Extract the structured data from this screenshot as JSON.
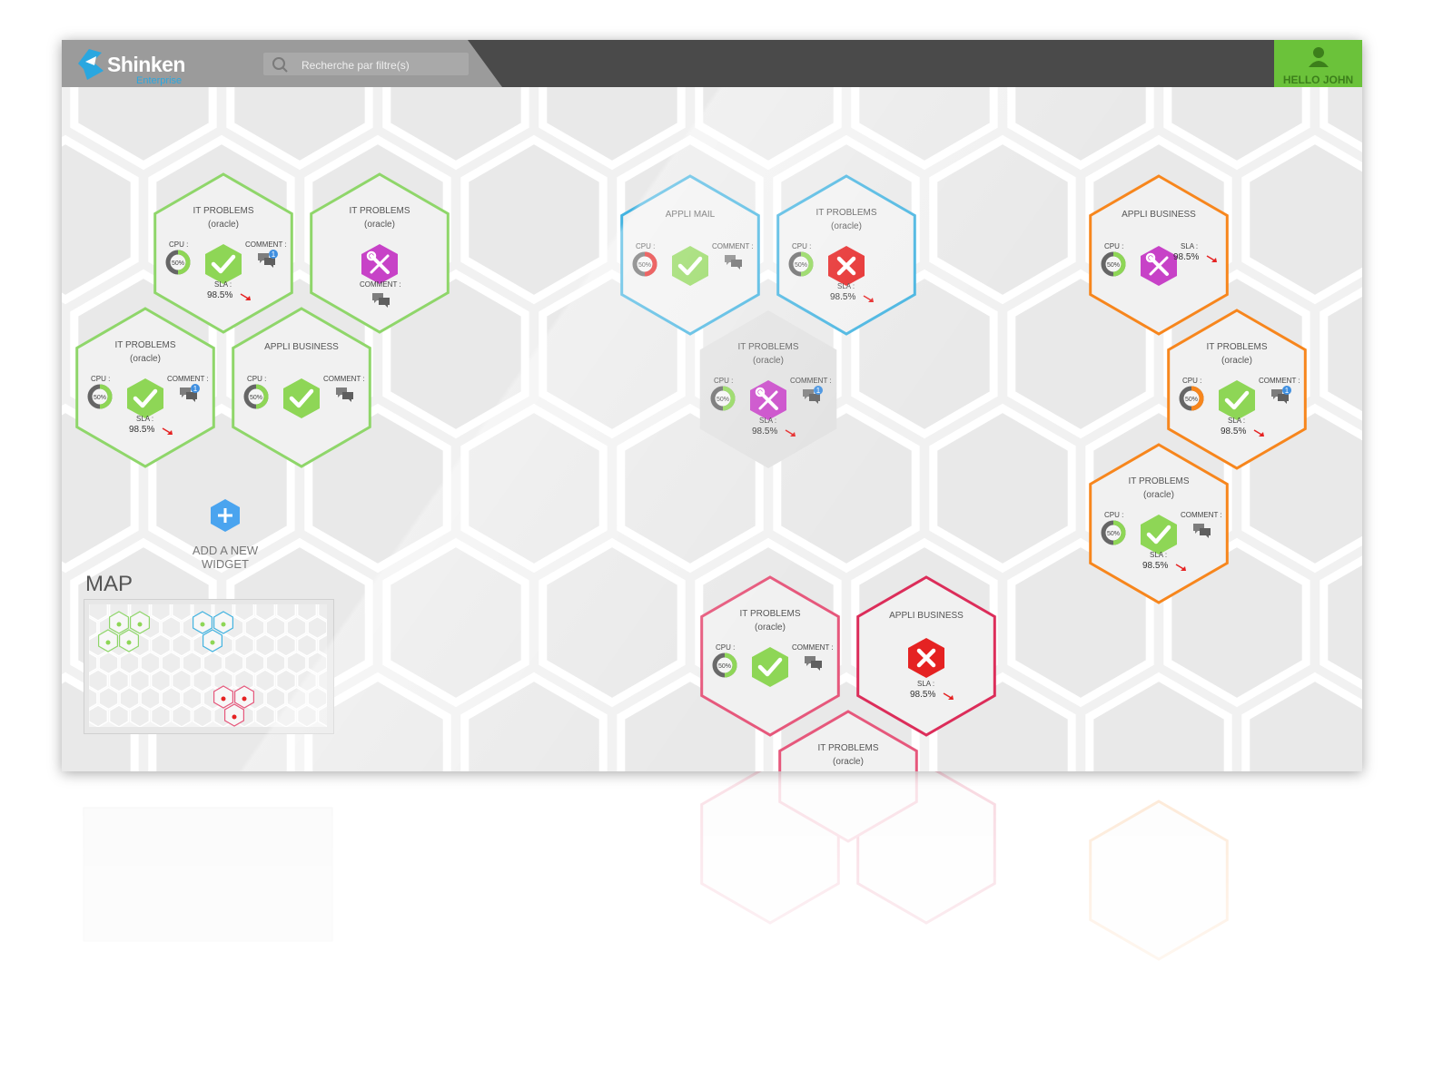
{
  "header": {
    "logo_text": "Shinken",
    "logo_sub": "Enterprise",
    "search_placeholder": "Recherche par filtre(s)",
    "user_label": "HELLO JOHN"
  },
  "labels": {
    "cpu": "CPU :",
    "comment": "COMMENT :",
    "sla": "SLA :",
    "cpu_value": "50%"
  },
  "colors": {
    "green": "#8fd66a",
    "blue": "#43b3e0",
    "orange": "#f7861d",
    "pink": "#e6587c",
    "crimson": "#dc2d5a",
    "ok": "#8ed656",
    "maintenance": "#c742c7",
    "critical": "#e52222",
    "badge": "#3f8fe0",
    "add": "#4aa4ef"
  },
  "widgets": [
    {
      "title": "IT PROBLEMS",
      "subtitle": "(oracle)",
      "color": "green",
      "status": "ok",
      "cpu": true,
      "comment": true,
      "comment_count": "1",
      "sla": "98.5%"
    },
    {
      "title": "IT PROBLEMS",
      "subtitle": "(oracle)",
      "color": "green",
      "status": "maintenance",
      "cpu": false,
      "comment": true,
      "comment_count": "",
      "sla": ""
    },
    {
      "title": "IT PROBLEMS",
      "subtitle": "(oracle)",
      "color": "green",
      "status": "ok",
      "cpu": true,
      "comment": true,
      "comment_count": "1",
      "sla": "98.5%"
    },
    {
      "title": "APPLI BUSINESS",
      "subtitle": "",
      "color": "green",
      "status": "ok",
      "cpu": true,
      "comment": true,
      "comment_count": "",
      "sla": ""
    },
    {
      "title": "APPLI MAIL",
      "subtitle": "",
      "color": "blue",
      "status": "ok",
      "cpu": true,
      "cpu_warn": true,
      "comment": true,
      "comment_count": "",
      "sla": ""
    },
    {
      "title": "IT PROBLEMS",
      "subtitle": "(oracle)",
      "color": "blue",
      "status": "critical",
      "cpu": true,
      "comment": false,
      "comment_count": "",
      "sla": "98.5%"
    },
    {
      "title": "IT PROBLEMS",
      "subtitle": "(oracle)",
      "color": "none",
      "status": "maintenance",
      "cpu": true,
      "comment": true,
      "comment_count": "1",
      "sla": "98.5%"
    },
    {
      "title": "APPLI BUSINESS",
      "subtitle": "",
      "color": "orange",
      "status": "maintenance",
      "cpu": true,
      "comment": false,
      "comment_count": "",
      "sla": "98.5%"
    },
    {
      "title": "IT PROBLEMS",
      "subtitle": "(oracle)",
      "color": "orange",
      "status": "ok",
      "cpu": true,
      "cpu_orange": true,
      "comment": true,
      "comment_count": "1",
      "sla": "98.5%"
    },
    {
      "title": "IT PROBLEMS",
      "subtitle": "(oracle)",
      "color": "orange",
      "status": "ok",
      "cpu": true,
      "comment": true,
      "comment_count": "",
      "sla": "98.5%"
    },
    {
      "title": "IT PROBLEMS",
      "subtitle": "(oracle)",
      "color": "pink",
      "status": "ok",
      "cpu": true,
      "comment": true,
      "comment_count": "",
      "sla": ""
    },
    {
      "title": "APPLI BUSINESS",
      "subtitle": "",
      "color": "crimson",
      "status": "critical",
      "cpu": false,
      "comment": false,
      "comment_count": "",
      "sla": "98.5%"
    },
    {
      "title": "IT PROBLEMS",
      "subtitle": "(oracle)",
      "color": "pink",
      "status": "none",
      "cpu": false,
      "comment": false,
      "comment_count": "",
      "sla": ""
    }
  ],
  "add_widget": {
    "line1": "ADD A NEW",
    "line2": "WIDGET"
  },
  "map": {
    "title": "MAP"
  }
}
